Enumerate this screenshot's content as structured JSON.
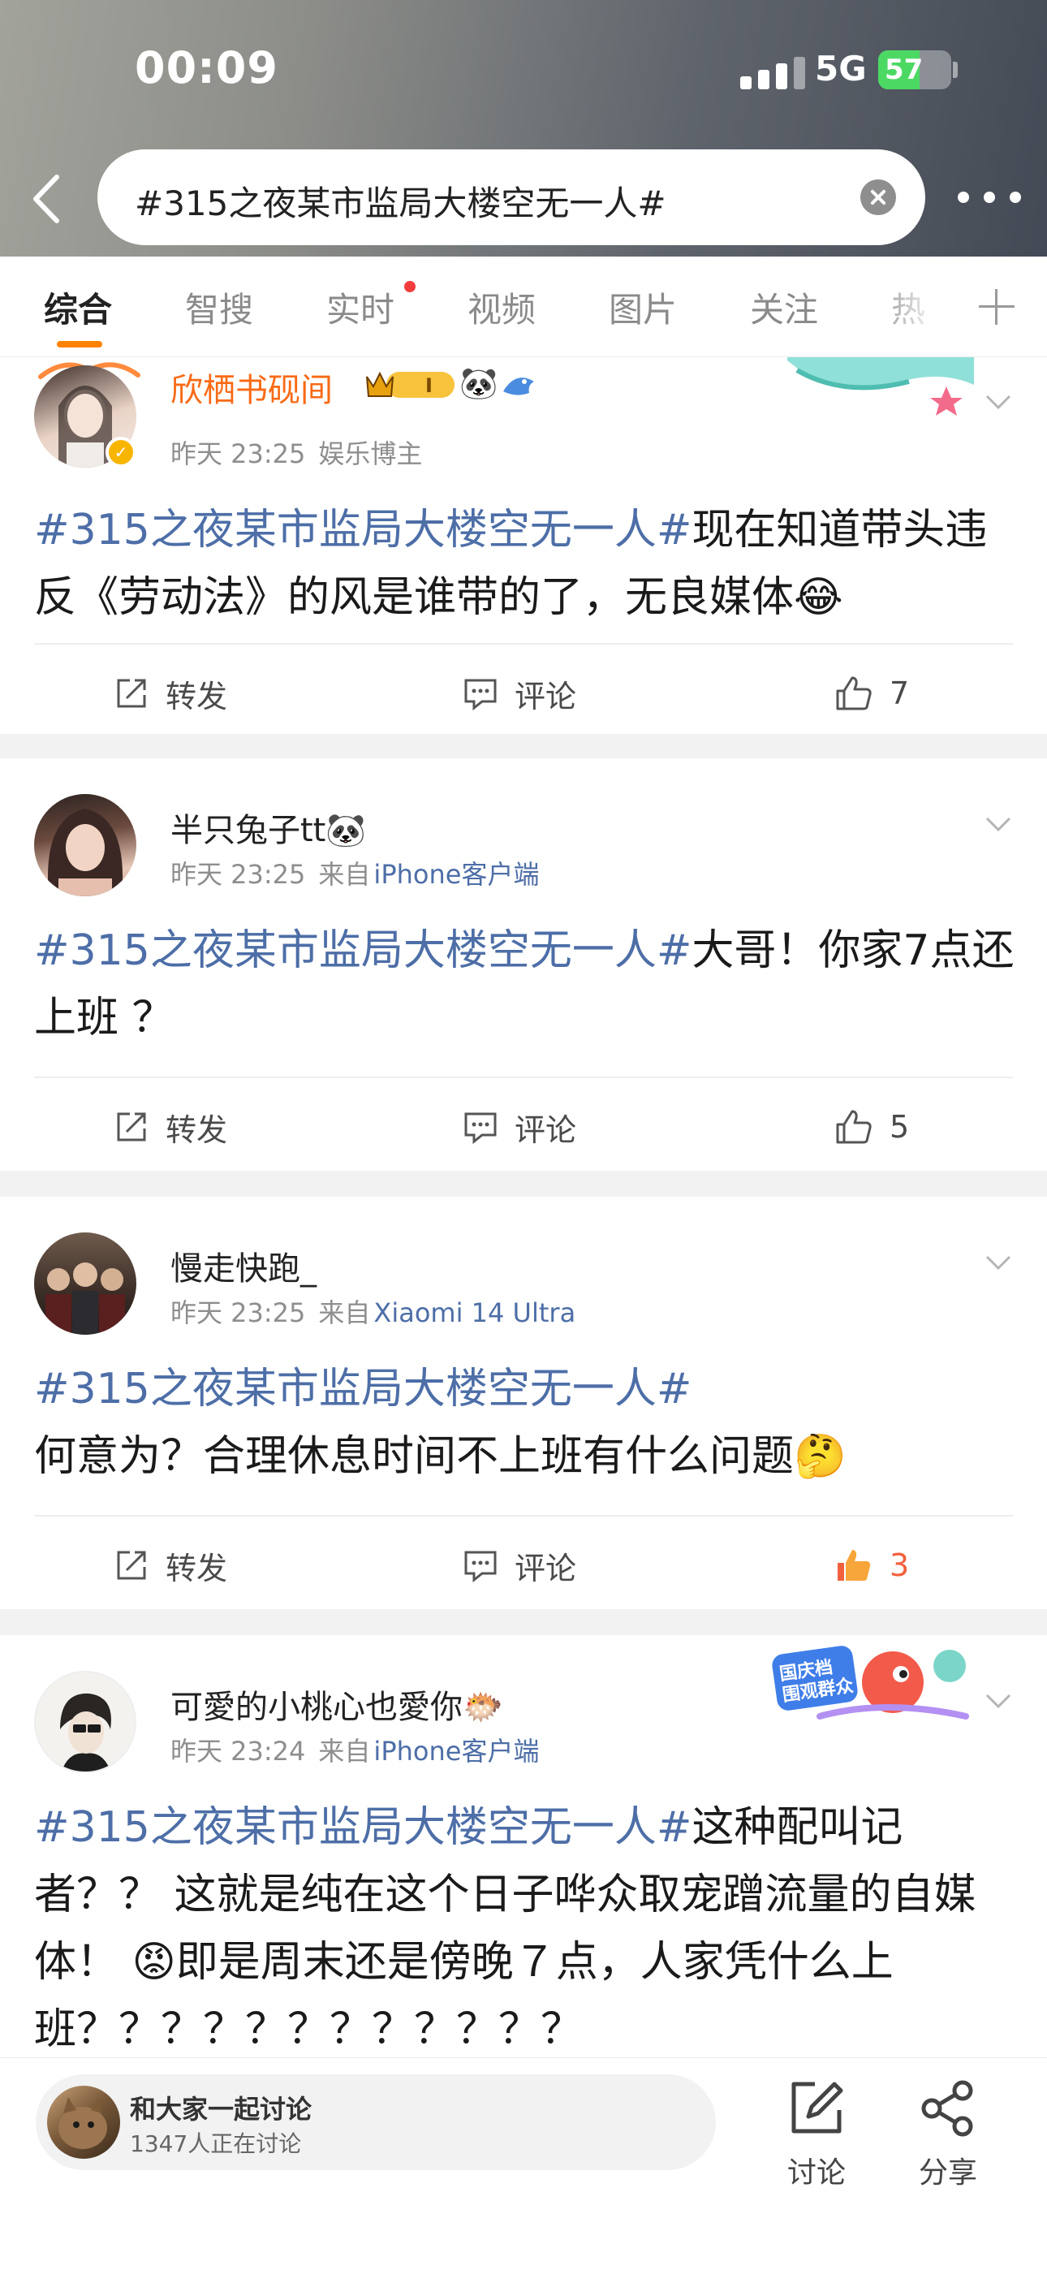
{
  "status_bar": {
    "time": "00:09",
    "network": "5G",
    "battery": "57",
    "battery_level": 0.57
  },
  "header": {
    "search_query": "#315之夜某市监局大楼空无一人#"
  },
  "tabs": [
    {
      "label": "综合",
      "active": true
    },
    {
      "label": "智搜"
    },
    {
      "label": "实时",
      "dot": true
    },
    {
      "label": "视频"
    },
    {
      "label": "图片"
    },
    {
      "label": "关注"
    },
    {
      "label": "热"
    }
  ],
  "posts": [
    {
      "user": "欣栖书砚间",
      "time": "昨天 23:25",
      "meta_label": "娱乐博主",
      "tag": "#315之夜某市监局大楼空无一人#",
      "text": "现在知道带头违反《劳动法》的风是谁带的了，无良媒体😂",
      "repost": "转发",
      "comment": "评论",
      "likes": "7"
    },
    {
      "user": "半只兔子tt🐼",
      "time": "昨天 23:25",
      "source_prefix": "来自",
      "source": "iPhone客户端",
      "tag": "#315之夜某市监局大楼空无一人#",
      "text": "大哥！你家7点还上班 ？",
      "repost": "转发",
      "comment": "评论",
      "likes": "5"
    },
    {
      "user": "慢走快跑_",
      "time": "昨天 23:25",
      "source_prefix": "来自",
      "source": "Xiaomi 14 Ultra",
      "tag": "#315之夜某市监局大楼空无一人#",
      "text": "何意为？合理休息时间不上班有什么问题🤔",
      "repost": "转发",
      "comment": "评论",
      "likes": "3",
      "liked": true
    },
    {
      "user": "可愛的小桃心也愛你🐡",
      "time": "昨天 23:24",
      "source_prefix": "来自",
      "source": "iPhone客户端",
      "tag": "#315之夜某市监局大楼空无一人#",
      "text": "这种配叫记者？？ 这就是纯在这个日子哗众取宠蹭流量的自媒体！ 😡即是周末还是傍晚７点，人家凭什么上班？？？？？？？？？？？？",
      "badge_text": "国庆档 围观群众"
    }
  ],
  "bottom_bar": {
    "discussion_title": "和大家一起讨论",
    "discussion_count": "1347人正在讨论",
    "discuss_label": "讨论",
    "share_label": "分享"
  }
}
